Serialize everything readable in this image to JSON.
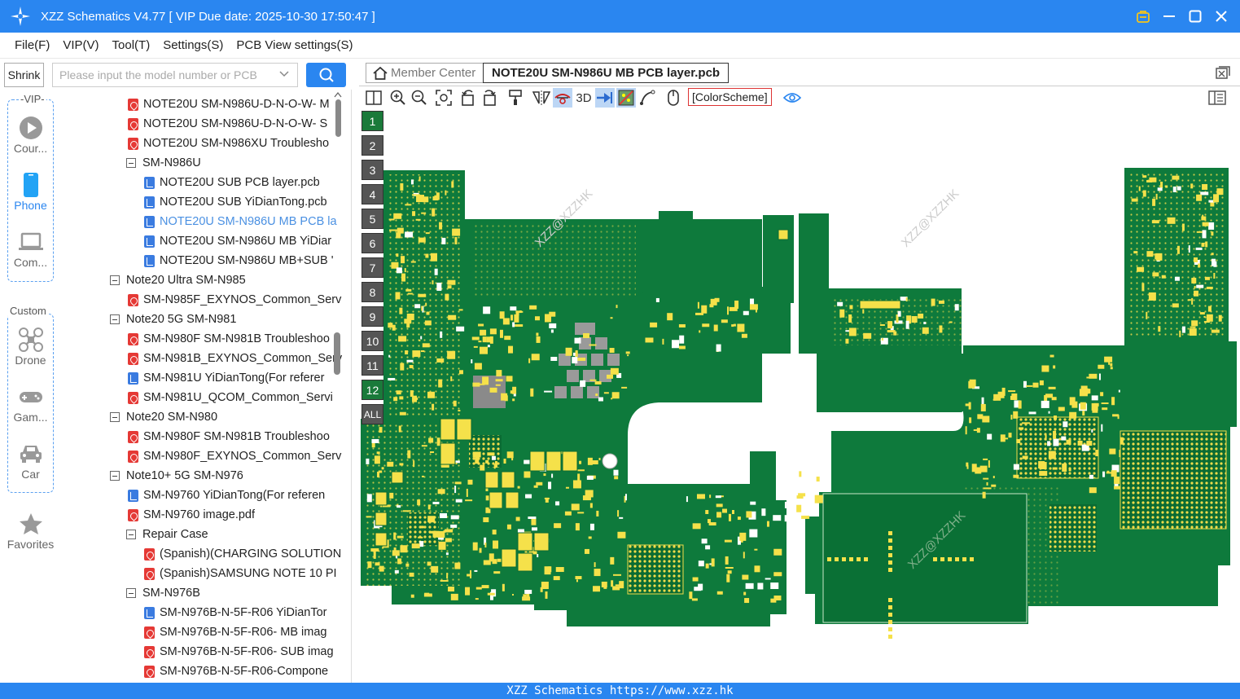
{
  "window": {
    "title": "XZZ Schematics V4.77 [ VIP Due date: 2025-10-30 17:50:47 ]"
  },
  "menu": [
    "File(F)",
    "VIP(V)",
    "Tool(T)",
    "Settings(S)",
    "PCB View settings(S)"
  ],
  "search": {
    "shrink_label": "Shrink",
    "placeholder": "Please input the model number or PCB"
  },
  "rail": {
    "vip_title": "-VIP-",
    "custom_title": "Custom",
    "items": [
      {
        "label": "Cour...",
        "icon": "play-icon"
      },
      {
        "label": "Phone",
        "icon": "phone-icon"
      },
      {
        "label": "Com...",
        "icon": "laptop-icon"
      },
      {
        "label": "Drone",
        "icon": "drone-icon"
      },
      {
        "label": "Gam...",
        "icon": "gamepad-icon"
      },
      {
        "label": "Car",
        "icon": "car-icon"
      },
      {
        "label": "Favorites",
        "icon": "star-icon"
      }
    ]
  },
  "tree": [
    {
      "label": "NOTE20U SM-N986U-D-N-O-W- M",
      "type": "pdf",
      "indent": 2
    },
    {
      "label": "NOTE20U SM-N986U-D-N-O-W- S",
      "type": "pdf",
      "indent": 2
    },
    {
      "label": "NOTE20U SM-N986XU Troublesho",
      "type": "pdf",
      "indent": 2
    },
    {
      "label": "SM-N986U",
      "type": "folder",
      "indent": 2
    },
    {
      "label": "NOTE20U  SUB PCB layer.pcb",
      "type": "pcb",
      "indent": 3
    },
    {
      "label": "NOTE20U  SUB YiDianTong.pcb",
      "type": "pcb",
      "indent": 3
    },
    {
      "label": "NOTE20U SM-N986U MB PCB la",
      "type": "pcb",
      "indent": 3,
      "selected": true
    },
    {
      "label": "NOTE20U SM-N986U MB YiDiar",
      "type": "pcb",
      "indent": 3
    },
    {
      "label": "NOTE20U SM-N986U MB+SUB '",
      "type": "pcb",
      "indent": 3
    },
    {
      "label": "Note20 Ultra SM-N985",
      "type": "folder",
      "indent": 1
    },
    {
      "label": "SM-N985F_EXYNOS_Common_Serv",
      "type": "pdf",
      "indent": 2
    },
    {
      "label": "Note20 5G SM-N981",
      "type": "folder",
      "indent": 1
    },
    {
      "label": "SM-N980F SM-N981B Troubleshoo",
      "type": "pdf",
      "indent": 2
    },
    {
      "label": "SM-N981B_EXYNOS_Common_Serv",
      "type": "pdf",
      "indent": 2
    },
    {
      "label": "SM-N981U YiDianTong(For referer",
      "type": "pcb",
      "indent": 2
    },
    {
      "label": "SM-N981U_QCOM_Common_Servi",
      "type": "pdf",
      "indent": 2
    },
    {
      "label": "Note20 SM-N980",
      "type": "folder",
      "indent": 1
    },
    {
      "label": "SM-N980F SM-N981B Troubleshoo",
      "type": "pdf",
      "indent": 2
    },
    {
      "label": "SM-N980F_EXYNOS_Common_Serv",
      "type": "pdf",
      "indent": 2
    },
    {
      "label": "Note10+ 5G SM-N976",
      "type": "folder",
      "indent": 1
    },
    {
      "label": "SM-N9760 YiDianTong(For referen",
      "type": "pcb",
      "indent": 2
    },
    {
      "label": "SM-N9760 image.pdf",
      "type": "pdf",
      "indent": 2
    },
    {
      "label": "Repair Case",
      "type": "folder",
      "indent": 2
    },
    {
      "label": "(Spanish)(CHARGING SOLUTION",
      "type": "pdf",
      "indent": 3
    },
    {
      "label": "(Spanish)SAMSUNG NOTE 10 PI",
      "type": "pdf",
      "indent": 3
    },
    {
      "label": "SM-N976B",
      "type": "folder",
      "indent": 2
    },
    {
      "label": "SM-N976B-N-5F-R06 YiDianTor",
      "type": "pcb",
      "indent": 3
    },
    {
      "label": "SM-N976B-N-5F-R06- MB imag",
      "type": "pdf",
      "indent": 3
    },
    {
      "label": "SM-N976B-N-5F-R06- SUB imag",
      "type": "pdf",
      "indent": 3
    },
    {
      "label": "SM-N976B-N-5F-R06-Compone",
      "type": "pdf",
      "indent": 3
    }
  ],
  "tabs": {
    "member": "Member Center",
    "active": "NOTE20U SM-N986U MB PCB layer.pcb"
  },
  "toolbar": {
    "three_d": "3D",
    "color_scheme": "[ColorScheme]"
  },
  "layers": [
    "1",
    "2",
    "3",
    "4",
    "5",
    "6",
    "7",
    "8",
    "9",
    "10",
    "11",
    "12",
    "ALL"
  ],
  "active_layers": [
    "1",
    "12"
  ],
  "watermark": "XZZ@XZZHK",
  "status": "XZZ Schematics https://www.xzz.hk",
  "colors": {
    "accent": "#2a86f0",
    "pcb_green": "#0e7a3c",
    "pad_yellow": "#f5e14a",
    "pcb_dark": "#096a30"
  }
}
